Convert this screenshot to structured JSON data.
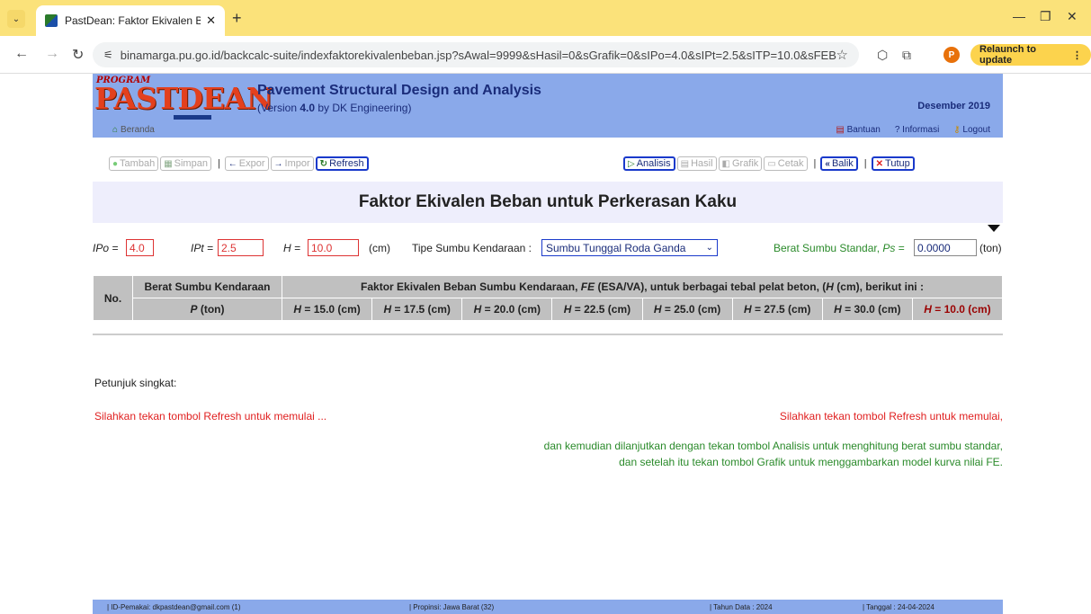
{
  "browser": {
    "tab_title": "PastDean: Faktor Ekivalen Beb",
    "url_site": "⚟",
    "url": "binamarga.pu.go.id/backcalc-suite/indexfaktorekivalenbeban.jsp?sAwal=9999&sHasil=0&sGrafik=0&sIPo=4.0&sIPt=2.5&sITP=10.0&sFEBTi...",
    "avatar": "P",
    "relaunch": "Relaunch to update"
  },
  "banner": {
    "logo_program": "PROGRAM",
    "logo_past": "PASTDEAN",
    "logo_m": "M",
    "title": "Pavement Structural Design and Analysis",
    "version_pre": "(Version ",
    "version_num": "4.0",
    "version_post": " by DK Engineering)",
    "date": "Desember 2019"
  },
  "subnav": {
    "beranda": "Beranda",
    "bantuan": "Bantuan",
    "informasi": "Informasi",
    "logout": "Logout"
  },
  "toolbar": {
    "tambah": "Tambah",
    "simpan": "Simpan",
    "expor": "Expor",
    "impor": "Impor",
    "refresh": "Refresh",
    "analisis": "Analisis",
    "hasil": "Hasil",
    "grafik": "Grafik",
    "cetak": "Cetak",
    "balik": "Balik",
    "tutup": "Tutup"
  },
  "page_title": "Faktor Ekivalen Beban untuk Perkerasan Kaku",
  "params": {
    "ipo_label": "IPo =",
    "ipo_value": "4.0",
    "ipt_label": "IPt =",
    "ipt_value": "2.5",
    "h_label": "H =",
    "h_value": "10.0",
    "h_unit": "(cm)",
    "tipe_label": "Tipe Sumbu Kendaraan :",
    "tipe_value": "Sumbu Tunggal Roda Ganda",
    "ps_label_pre": "Berat Sumbu Standar, ",
    "ps_label_var": "Ps",
    "ps_label_post": " =",
    "ps_value": "0.0000",
    "ps_unit": "(ton)"
  },
  "table": {
    "no": "No.",
    "berat_header": "Berat Sumbu Kendaraan",
    "fe_header_pre": "Faktor Ekivalen Beban Sumbu Kendaraan, ",
    "fe_header_var": "FE",
    "fe_header_mid": " (ESA/VA), untuk berbagai tebal pelat beton, (",
    "fe_header_var2": "H",
    "fe_header_post": " (cm), berikut ini :",
    "p_var": "P",
    "p_unit": " (ton)",
    "h_cols": [
      "15.0",
      "17.5",
      "20.0",
      "22.5",
      "25.0",
      "27.5",
      "30.0",
      "10.0"
    ]
  },
  "hints": {
    "label": "Petunjuk singkat:",
    "left_red": "Silahkan tekan tombol Refresh untuk memulai ...",
    "right_red": "Silahkan tekan tombol Refresh untuk memulai,",
    "green1": "dan kemudian dilanjutkan dengan tekan tombol Analisis untuk menghitung berat sumbu standar,",
    "green2": "dan setelah itu tekan tombol Grafik untuk menggambarkan model kurva nilai FE."
  },
  "footer": {
    "user": "| ID-Pemakai: dkpastdean@gmail.com (1)",
    "propinsi": "| Propinsi: Jawa Barat (32)",
    "tahun": "| Tahun Data : 2024",
    "tanggal": "| Tanggal : 24-04-2024"
  }
}
